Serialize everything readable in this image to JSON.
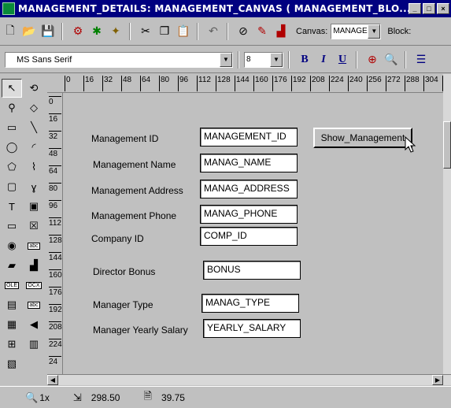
{
  "window": {
    "title": "MANAGEMENT_DETAILS: MANAGEMENT_CANVAS ( MANAGEMENT_BLO...",
    "controls": [
      "_",
      "□",
      "×"
    ]
  },
  "toolbar1": {
    "icons": [
      "new-file-icon",
      "open-folder-icon",
      "save-icon",
      "run-form-icon",
      "debug-icon",
      "compile-icon",
      "cut-icon",
      "copy-icon",
      "paste-icon",
      "undo-icon",
      "clear-icon",
      "edit-icon",
      "chart-icon"
    ],
    "canvas_label": "Canvas:",
    "canvas_value": "MANAGE",
    "block_label": "Block:"
  },
  "toolbar2": {
    "font_name": "MS Sans Serif",
    "font_size": "8",
    "bold": "B",
    "italic": "I",
    "underline": "U"
  },
  "ruler_h": [
    "0",
    "16",
    "32",
    "48",
    "64",
    "80",
    "96",
    "112",
    "128",
    "144",
    "160",
    "176",
    "192",
    "208",
    "224",
    "240",
    "256",
    "272",
    "288",
    "304",
    "32"
  ],
  "ruler_v": [
    "0",
    "16",
    "32",
    "48",
    "64",
    "80",
    "96",
    "112",
    "128",
    "144",
    "160",
    "176",
    "192",
    "208",
    "224",
    "24"
  ],
  "palette": [
    "select-arrow-icon",
    "rotate-icon",
    "magnify-icon",
    "reshape-icon",
    "rectangle-icon",
    "line-icon",
    "ellipse-icon",
    "arc-icon",
    "polygon-icon",
    "polyline-icon",
    "rounded-rect-icon",
    "freehand-icon",
    "text-icon",
    "frame-icon",
    "button-icon",
    "checkbox-icon",
    "radio-icon",
    "text-item-icon",
    "image-icon",
    "chart-icon",
    "ole-icon",
    "ocx-icon",
    "list-icon",
    "display-item-icon",
    "vbx-icon",
    "sound-icon",
    "hierarchical-tree-icon",
    "bean-icon",
    "stacked-canvas-icon"
  ],
  "form": {
    "fields": [
      {
        "label": "Management ID",
        "value": "MANAGEMENT_ID"
      },
      {
        "label": "Management Name",
        "value": "MANAG_NAME"
      },
      {
        "label": "Management Address",
        "value": "MANAG_ADDRESS"
      },
      {
        "label": "Management Phone",
        "value": "MANAG_PHONE"
      },
      {
        "label": "Company ID",
        "value": "COMP_ID"
      },
      {
        "label": "Director Bonus",
        "value": "BONUS"
      },
      {
        "label": "Manager Type",
        "value": "MANAG_TYPE"
      },
      {
        "label": "Manager Yearly Salary",
        "value": "YEARLY_SALARY"
      }
    ],
    "button_label": "Show_Management"
  },
  "status": {
    "zoom": "1x",
    "position": "298.50",
    "size": "39.75"
  }
}
